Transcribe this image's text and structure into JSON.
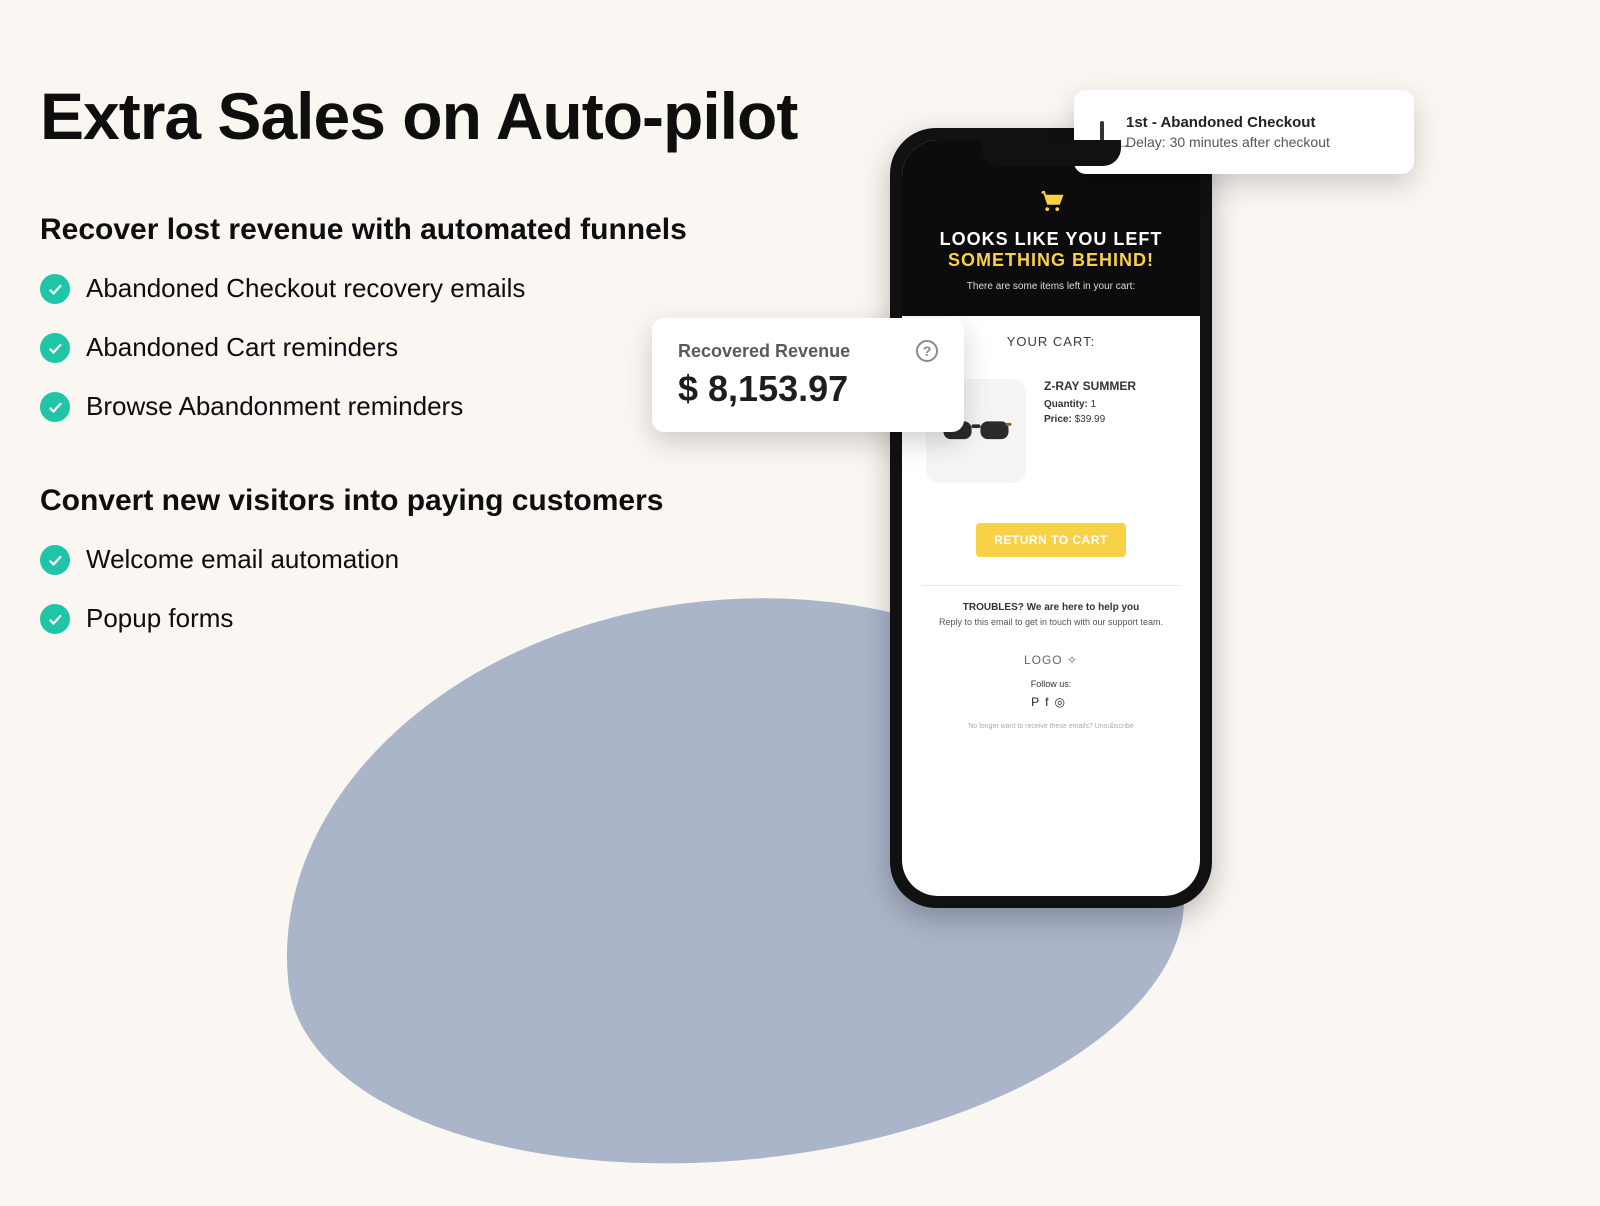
{
  "headline": "Extra Sales on Auto-pilot",
  "section1": {
    "title": "Recover lost revenue with automated funnels",
    "items": [
      "Abandoned Checkout recovery emails",
      "Abandoned Cart reminders",
      "Browse Abandonment reminders"
    ]
  },
  "section2": {
    "title": "Convert new visitors into paying customers",
    "items": [
      "Welcome email automation",
      "Popup forms"
    ]
  },
  "revenue_card": {
    "label": "Recovered Revenue",
    "value": "$ 8,153.97"
  },
  "step_card": {
    "title": "1st - Abandoned Checkout",
    "subtitle": "Delay: 30 minutes after checkout"
  },
  "email": {
    "hero_line1": "LOOKS LIKE YOU LEFT",
    "hero_line2": "SOMETHING BEHIND!",
    "hero_sub": "There are some items left in your cart:",
    "cart_title": "YOUR CART:",
    "product": {
      "name": "Z-RAY SUMMER",
      "qty_label": "Quantity:",
      "qty": "1",
      "price_label": "Price:",
      "price": "$39.99"
    },
    "cta": "RETURN TO CART",
    "footer_title": "TROUBLES? We are here to help you",
    "footer_sub": "Reply to this email to get in touch with our support team.",
    "logo": "LOGO ✧",
    "follow": "Follow us:",
    "legal": "No longer want to receive these emails?  Unsubscribe"
  }
}
